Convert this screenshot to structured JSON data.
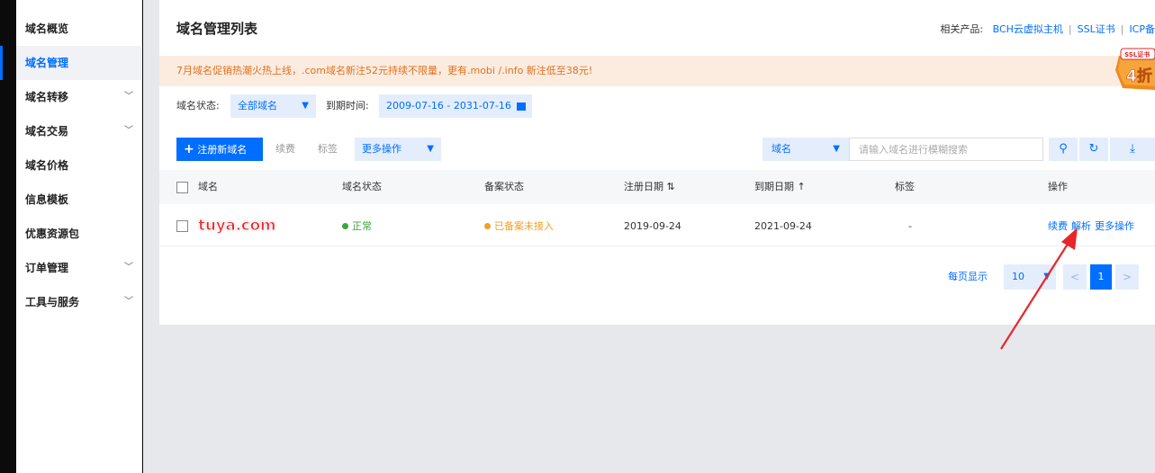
{
  "sidebar": {
    "items": [
      {
        "label": "域名概览",
        "expandable": false
      },
      {
        "label": "域名管理",
        "expandable": false,
        "active": true
      },
      {
        "label": "域名转移",
        "expandable": true
      },
      {
        "label": "域名交易",
        "expandable": true
      },
      {
        "label": "域名价格",
        "expandable": false
      },
      {
        "label": "信息模板",
        "expandable": false
      },
      {
        "label": "优惠资源包",
        "expandable": false
      },
      {
        "label": "订单管理",
        "expandable": true
      },
      {
        "label": "工具与服务",
        "expandable": true
      }
    ]
  },
  "header": {
    "title": "域名管理列表",
    "related_label": "相关产品:",
    "related_links": [
      "BCH云虚拟主机",
      "SSL证书",
      "ICP备"
    ]
  },
  "promo": {
    "text": "7月域名促销热潮火热上线，.com域名新注52元持续不限量，更有.mobi /.info 新注低至38元!",
    "badge_top": "SSL证书",
    "badge_main": "4折"
  },
  "filters": {
    "status_label": "域名状态:",
    "status_value": "全部域名",
    "expire_label": "到期时间:",
    "expire_range": "2009-07-16 - 2031-07-16"
  },
  "toolbar": {
    "register_label": "注册新域名",
    "renew_label": "续费",
    "tag_label": "标签",
    "more_label": "更多操作",
    "search_type": "域名",
    "search_placeholder": "请输入域名进行模糊搜索"
  },
  "table": {
    "columns": [
      "域名",
      "域名状态",
      "备案状态",
      "注册日期",
      "到期日期",
      "标签",
      "操作"
    ],
    "rows": [
      {
        "domain": "tuya.com",
        "status": "正常",
        "icp_status": "已备案未接入",
        "reg_date": "2019-09-24",
        "exp_date": "2021-09-24",
        "tag": "-",
        "actions": [
          "续费",
          "解析",
          "更多操作"
        ]
      }
    ]
  },
  "pagination": {
    "per_page_label": "每页显示",
    "per_page_value": "10",
    "current_page": "1"
  },
  "colors": {
    "accent": "#006eff",
    "promo_text": "#e26f1a",
    "status_ok": "#3ea53a",
    "status_warn": "#f0a020",
    "arrow": "#e8262a"
  }
}
